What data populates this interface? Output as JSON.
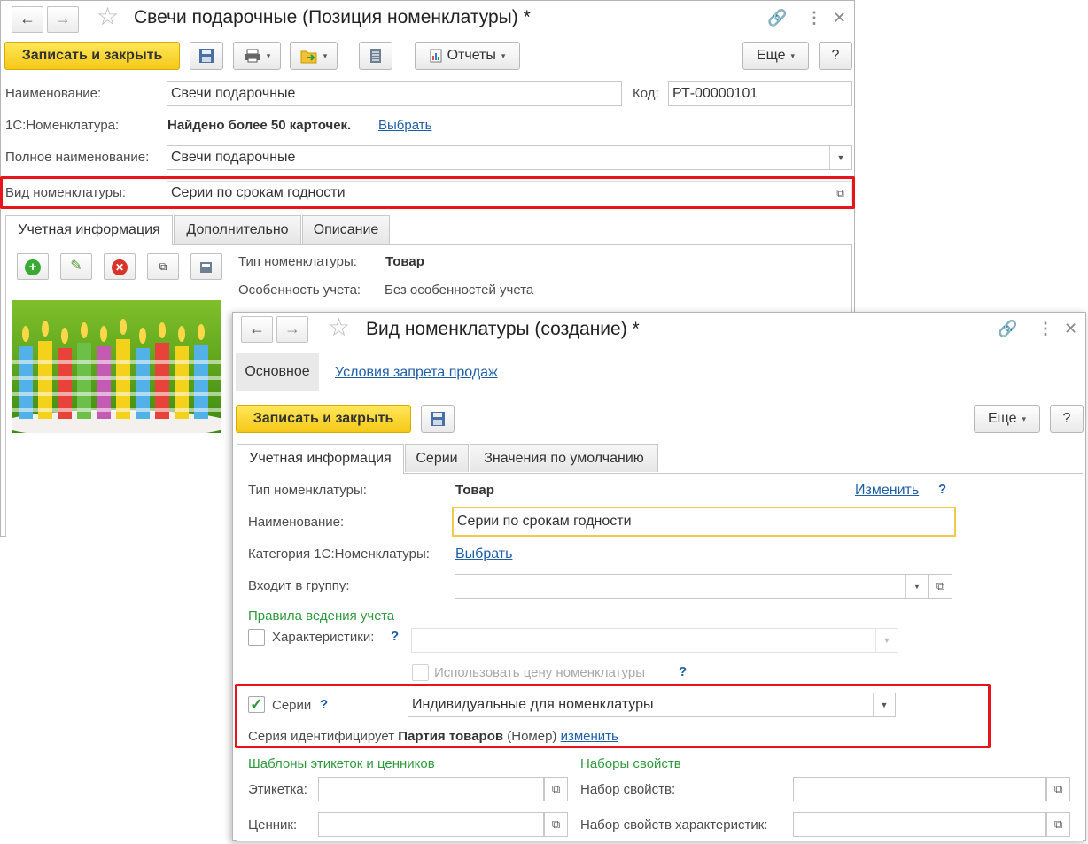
{
  "w1": {
    "title": "Свечи подарочные (Позиция номенклатуры) *",
    "nav_back": "←",
    "nav_fwd": "→",
    "save_close": "Записать и закрыть",
    "reports": "Отчеты",
    "more": "Еще",
    "help": "?",
    "name_label": "Наименование:",
    "name_value": "Свечи подарочные",
    "code_label": "Код:",
    "code_value": "РТ-00000101",
    "nom1c_label": "1С:Номенклатура:",
    "nom1c_found": "Найдено более 50 карточек.",
    "nom1c_select": "Выбрать",
    "fullname_label": "Полное наименование:",
    "fullname_value": "Свечи подарочные",
    "kind_label": "Вид номенклатуры:",
    "kind_value": "Серии по срокам годности",
    "tabs": [
      "Учетная информация",
      "Дополнительно",
      "Описание"
    ],
    "type_label": "Тип номенклатуры:",
    "type_value": "Товар",
    "feature_label": "Особенность учета:",
    "feature_value": "Без особенностей учета"
  },
  "w2": {
    "title": "Вид номенклатуры  (создание) *",
    "nav_back": "←",
    "nav_fwd": "→",
    "section_main": "Основное",
    "section_link": "Условия запрета продаж",
    "save_close": "Записать и закрыть",
    "more": "Еще",
    "help": "?",
    "tabs": [
      "Учетная информация",
      "Серии",
      "Значения по умолчанию"
    ],
    "type_label": "Тип номенклатуры:",
    "type_value": "Товар",
    "type_change": "Изменить",
    "q": "?",
    "name_label": "Наименование:",
    "name_value": "Серии по срокам годности",
    "cat_label": "Категория 1С:Номенклатуры:",
    "cat_select": "Выбрать",
    "group_label": "Входит в группу:",
    "group_value": "",
    "rules_header": "Правила ведения учета",
    "chars_label": "Характеристики:",
    "chars_checked": false,
    "use_price_label": "Использовать цену номенклатуры",
    "use_price_checked": false,
    "series_label": "Серии",
    "series_checked": true,
    "series_value": "Индивидуальные для номенклатуры",
    "series_id_prefix": "Серия идентифицирует",
    "series_id_value": "Партия товаров",
    "series_id_suffix": "(Номер)",
    "series_id_change": "изменить",
    "templates_header": "Шаблоны этикеток и ценников",
    "label_label": "Этикетка:",
    "label_value": "",
    "price_tag_label": "Ценник:",
    "price_tag_value": "",
    "props_header": "Наборы свойств",
    "props_label": "Набор свойств:",
    "props_value": "",
    "char_props_label": "Набор свойств характеристик:",
    "char_props_value": ""
  },
  "colors": {
    "accent_yellow": "#f5c817",
    "highlight_red": "#e8141a",
    "section_green": "#2f9a3d",
    "link_blue": "#1f5ea8"
  }
}
